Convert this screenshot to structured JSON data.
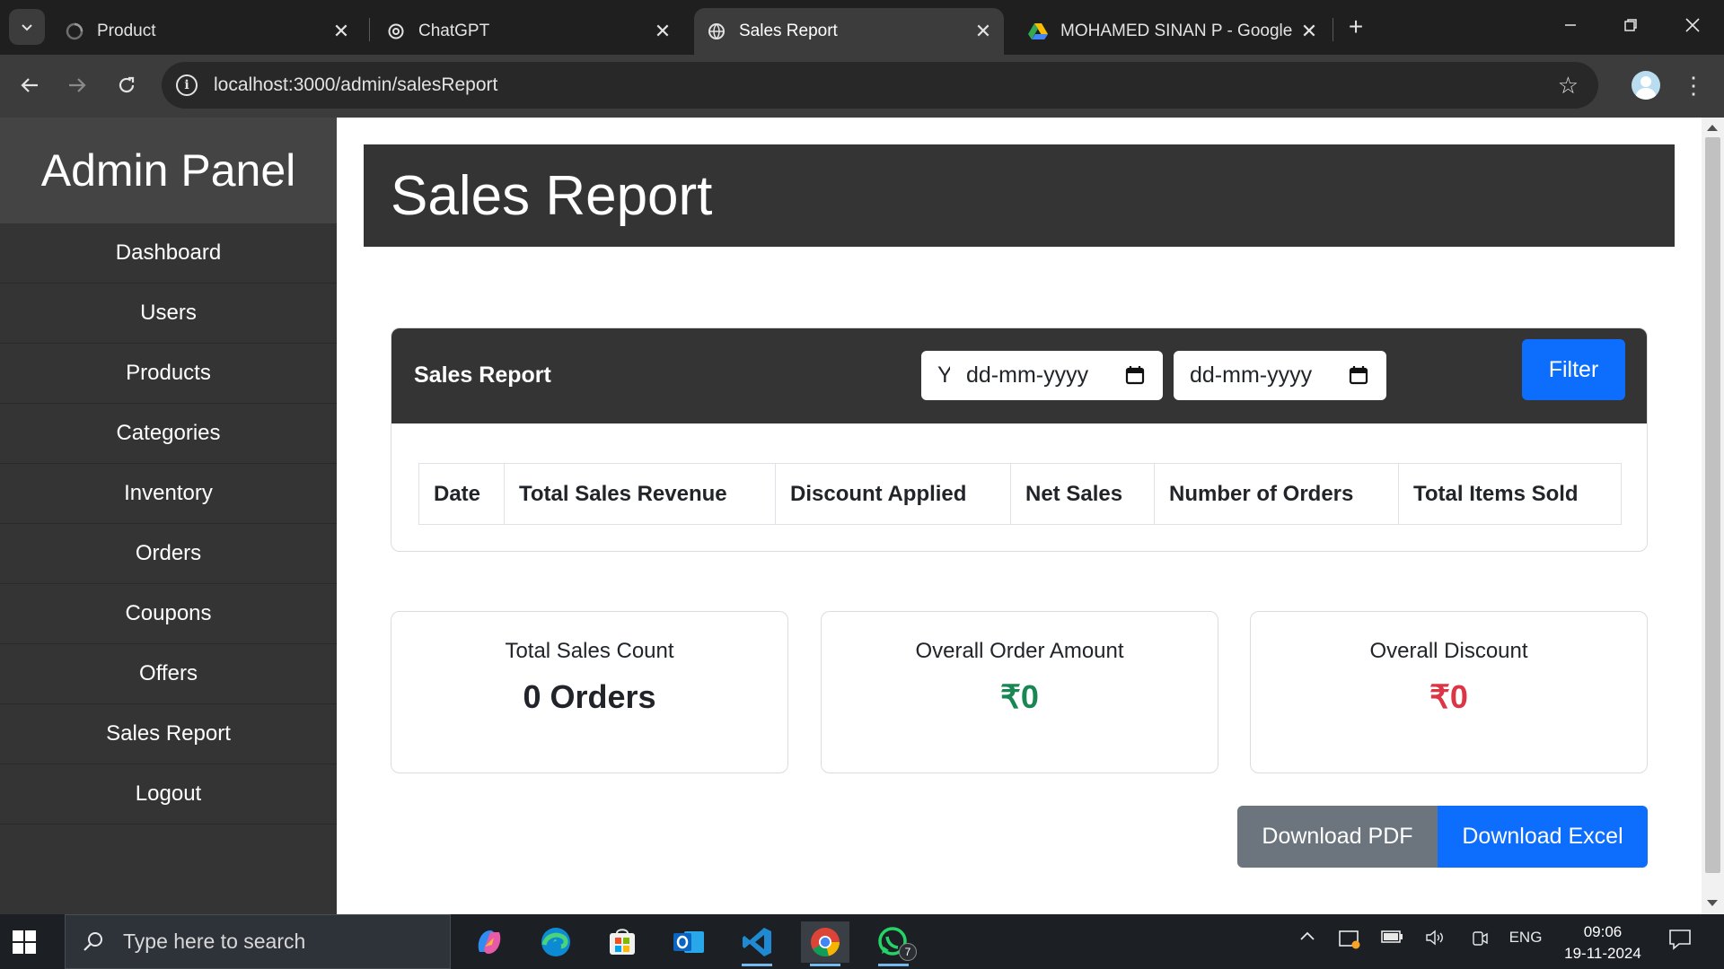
{
  "browser": {
    "tabs": [
      {
        "title": "Product",
        "active": false
      },
      {
        "title": "ChatGPT",
        "active": false
      },
      {
        "title": "Sales Report",
        "active": true
      },
      {
        "title": "MOHAMED SINAN P - Google D",
        "active": false
      }
    ],
    "url": "localhost:3000/admin/salesReport"
  },
  "sidebar": {
    "brand": "Admin Panel",
    "items": [
      "Dashboard",
      "Users",
      "Products",
      "Categories",
      "Inventory",
      "Orders",
      "Coupons",
      "Offers",
      "Sales Report",
      "Logout"
    ]
  },
  "header": {
    "title": "Sales Report"
  },
  "report": {
    "title": "Sales Report",
    "period_select": "Yearly",
    "start_date_placeholder": "dd-mm-yyyy",
    "end_date_placeholder": "dd-mm-yyyy",
    "filter_label": "Filter",
    "columns": [
      "Date",
      "Total Sales Revenue",
      "Discount Applied",
      "Net Sales",
      "Number of Orders",
      "Total Items Sold"
    ],
    "rows": []
  },
  "stats": [
    {
      "label": "Total Sales Count",
      "value": "0 Orders",
      "color": "#212529"
    },
    {
      "label": "Overall Order Amount",
      "value": "₹0",
      "color": "#198754"
    },
    {
      "label": "Overall Discount",
      "value": "₹0",
      "color": "#dc3545"
    }
  ],
  "actions": {
    "download_pdf": "Download PDF",
    "download_excel": "Download Excel"
  },
  "colors": {
    "primary": "#0d6efd",
    "secondary": "#6c757d",
    "dark": "#343434"
  },
  "taskbar": {
    "search_placeholder": "Type here to search",
    "whatsapp_badge": "7",
    "language": "ENG",
    "time": "09:06",
    "date": "19-11-2024"
  }
}
